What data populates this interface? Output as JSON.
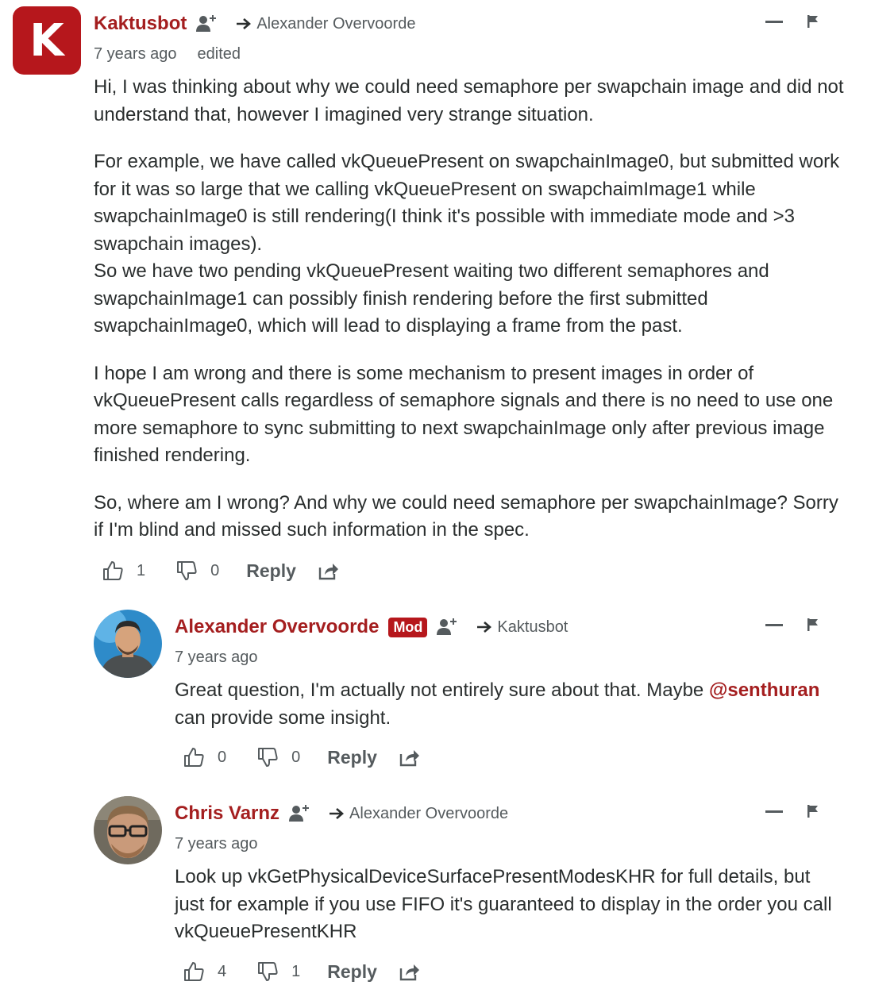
{
  "comments": [
    {
      "avatar_letter": "K",
      "author": "Kaktusbot",
      "reply_to": "Alexander Overvoorde",
      "time": "7 years ago",
      "edited": "edited",
      "paragraphs": [
        "Hi, I was thinking about why we could need semaphore per swapchain image and did not understand that, however I imagined very strange situation.",
        "For example, we have called vkQueuePresent on swapchainImage0, but submitted work for it was so large that we calling vkQueuePresent on swapchaimImage1 while swapchainImage0 is still rendering(I think it's possible with immediate mode and >3 swapchain images).",
        "So we have two pending vkQueuePresent waiting two different semaphores and swapchainImage1 can possibly finish rendering before the first submitted swapchainImage0, which will lead to displaying a frame from the past.",
        "I hope I am wrong and there is some mechanism to present images in order of vkQueuePresent calls regardless of semaphore signals and there is no need to use one more semaphore to sync submitting to next swapchainImage only after previous image finished rendering.",
        "So, where am I wrong? And why we could need semaphore per swapchainImage? Sorry if I'm blind and missed such information in the spec."
      ],
      "upvotes": "1",
      "downvotes": "0",
      "reply_label": "Reply"
    },
    {
      "author": "Alexander Overvoorde",
      "badge": "Mod",
      "reply_to": "Kaktusbot",
      "time": "7 years ago",
      "text_before": "Great question, I'm actually not entirely sure about that. Maybe ",
      "mention": "@senthuran",
      "text_after": " can provide some insight.",
      "upvotes": "0",
      "downvotes": "0",
      "reply_label": "Reply"
    },
    {
      "author": "Chris Varnz",
      "reply_to": "Alexander Overvoorde",
      "time": "7 years ago",
      "text": "Look up vkGetPhysicalDeviceSurfacePresentModesKHR for full details, but just for example if you use FIFO it's guaranteed to display in the order you call vkQueuePresentKHR",
      "upvotes": "4",
      "downvotes": "1",
      "reply_label": "Reply"
    }
  ],
  "colors": {
    "accent": "#a41e1f",
    "badge": "#b6171c",
    "muted": "#555b5e",
    "text": "#2a2e2e"
  },
  "icons": [
    "follow-icon",
    "reply-arrow-icon",
    "collapse-icon",
    "flag-icon",
    "thumbs-up-icon",
    "thumbs-down-icon",
    "share-icon"
  ]
}
